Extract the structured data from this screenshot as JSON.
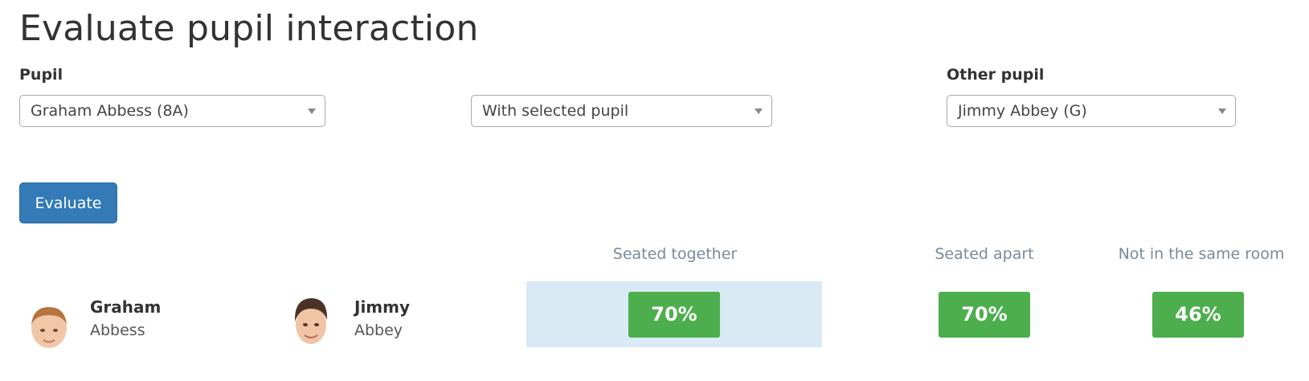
{
  "page": {
    "title": "Evaluate pupil interaction"
  },
  "filters": {
    "pupil_label": "Pupil",
    "pupil_value": "Graham Abbess (8A)",
    "mode_value": "With selected pupil",
    "other_label": "Other pupil",
    "other_value": "Jimmy Abbey (G)"
  },
  "actions": {
    "evaluate_label": "Evaluate"
  },
  "results": {
    "columns": [
      "Seated together",
      "Seated apart",
      "Not in the same room"
    ],
    "pupil_a": {
      "first": "Graham",
      "last": "Abbess"
    },
    "pupil_b": {
      "first": "Jimmy",
      "last": "Abbey"
    },
    "scores": [
      "70%",
      "70%",
      "46%"
    ],
    "score_color": "#4cae4c",
    "highlight_color": "#d9eaf5"
  }
}
